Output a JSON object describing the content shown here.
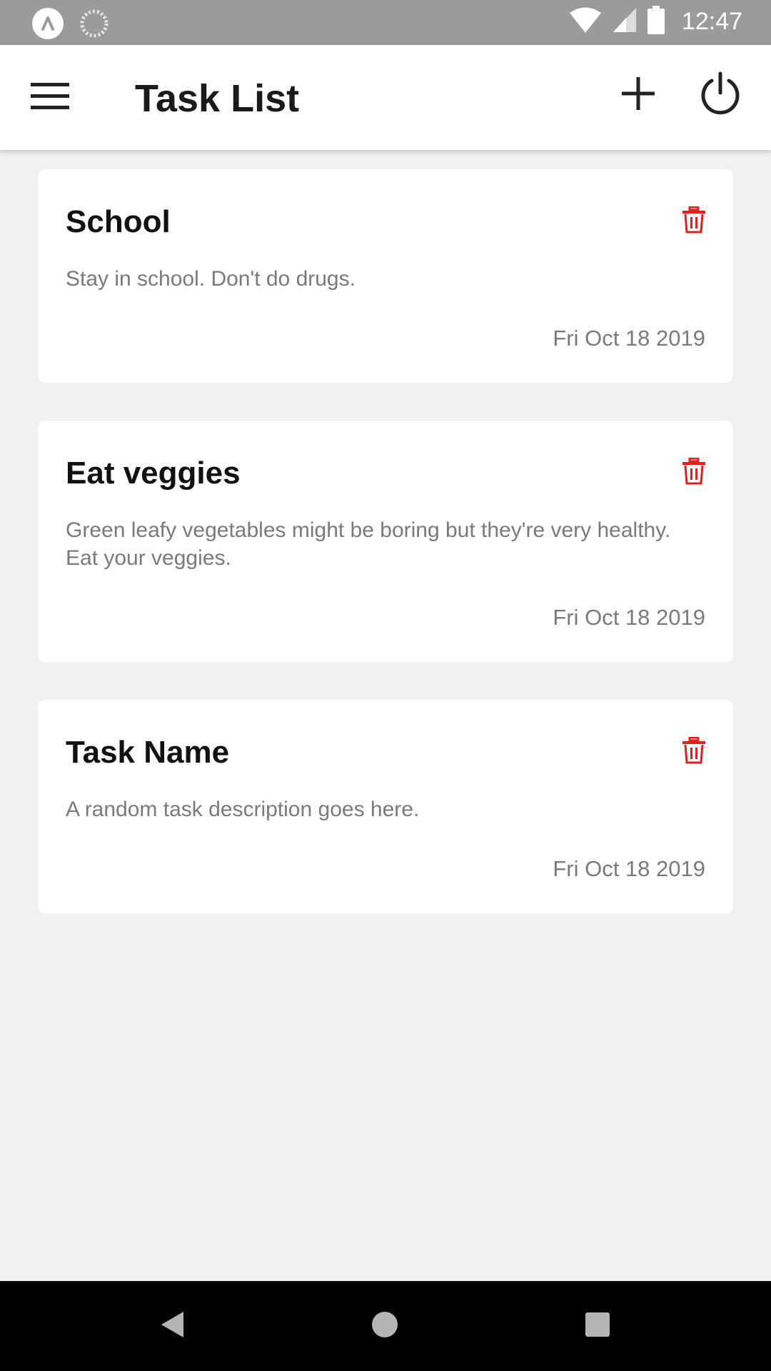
{
  "status_bar": {
    "time": "12:47",
    "icons": [
      "app-logo-icon",
      "loading-icon",
      "wifi-icon",
      "cell-signal-icon",
      "battery-icon"
    ]
  },
  "app_bar": {
    "title": "Task List",
    "icons": [
      "menu-icon",
      "plus-icon",
      "power-icon"
    ]
  },
  "tasks": [
    {
      "title": "School",
      "description": "Stay in school. Don't do drugs.",
      "date": "Fri Oct 18 2019"
    },
    {
      "title": "Eat veggies",
      "description": "Green leafy vegetables might be boring but they're very healthy. Eat your veggies.",
      "date": "Fri Oct 18 2019"
    },
    {
      "title": "Task Name",
      "description": "A random task description goes here.",
      "date": "Fri Oct 18 2019"
    }
  ],
  "nav_bar": {
    "icons": [
      "back-icon",
      "home-icon",
      "recents-icon"
    ]
  },
  "colors": {
    "status_bar": "#9b9b9b",
    "app_bar": "#ffffff",
    "background": "#f1f1f1",
    "delete_icon": "#e0201a",
    "nav_bar": "#000000"
  }
}
